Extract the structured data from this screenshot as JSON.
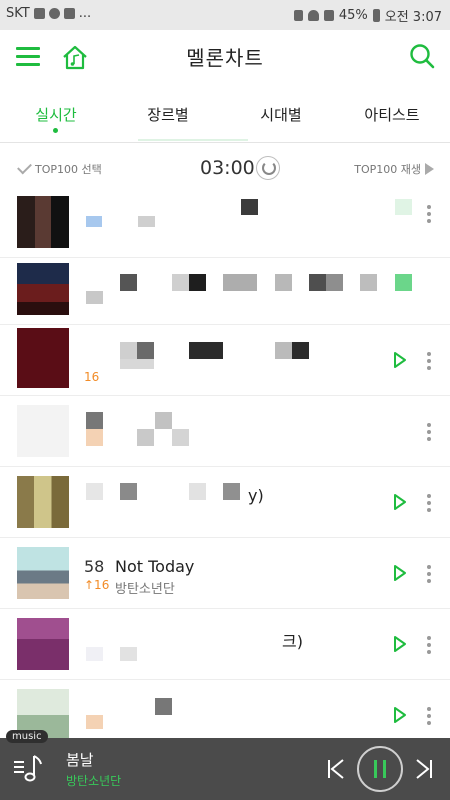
{
  "status_bar": {
    "carrier": "SKT",
    "battery": "45%",
    "time": "오전 3:07",
    "notif_more": "..."
  },
  "header": {
    "title": "멜론차트"
  },
  "tabs": [
    {
      "label": "실시간",
      "active": true
    },
    {
      "label": "장르별",
      "active": false
    },
    {
      "label": "시대별",
      "active": false
    },
    {
      "label": "아티스트",
      "active": false
    }
  ],
  "controls": {
    "select_label": "TOP100 선택",
    "time": "03:00",
    "play_label": "TOP100 재생"
  },
  "chart": {
    "rows": [
      {
        "rank": "",
        "song": "",
        "change": "",
        "artist": ""
      },
      {
        "rank": "",
        "song": "",
        "change": "",
        "artist": ""
      },
      {
        "rank": "",
        "song": "",
        "change": "16",
        "artist": ""
      },
      {
        "rank": "",
        "song": "",
        "change": "",
        "artist": ""
      },
      {
        "rank": "",
        "song": "y)",
        "change": "",
        "artist": ""
      },
      {
        "rank": "58",
        "song": "Not Today",
        "change": "↑16",
        "artist": "방탄소년단"
      },
      {
        "rank": "",
        "song": "크)",
        "change": "",
        "artist": ""
      },
      {
        "rank": "",
        "song": "",
        "change": "",
        "artist": ""
      }
    ]
  },
  "player": {
    "badge": "music",
    "title": "봄날",
    "artist": "방탄소년단"
  },
  "colors": {
    "accent": "#1fbc3f",
    "rank_up": "#f28c28",
    "player_bg": "#4b4b4b"
  }
}
